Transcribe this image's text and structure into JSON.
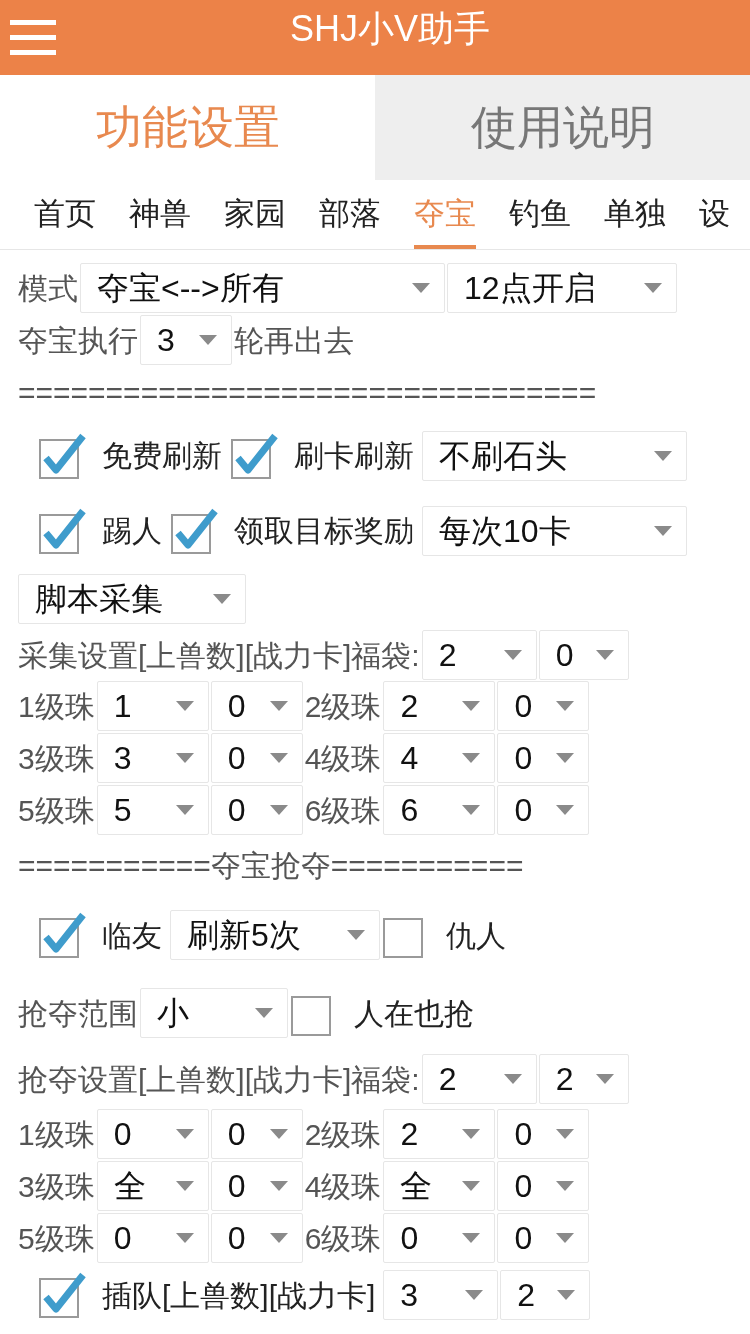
{
  "app_bar": {
    "title": "SHJ小V助手"
  },
  "main_tabs": [
    {
      "label": "功能设置",
      "selected": true
    },
    {
      "label": "使用说明",
      "selected": false
    }
  ],
  "sub_tabs": [
    {
      "label": "首页",
      "selected": false
    },
    {
      "label": "神兽",
      "selected": false
    },
    {
      "label": "家园",
      "selected": false
    },
    {
      "label": "部落",
      "selected": false
    },
    {
      "label": "夺宝",
      "selected": true
    },
    {
      "label": "钓鱼",
      "selected": false
    },
    {
      "label": "单独",
      "selected": false
    },
    {
      "label": "设",
      "selected": false
    }
  ],
  "rows": [
    {
      "items": [
        {
          "kind": "label",
          "text": "模式"
        },
        {
          "kind": "select",
          "value": "夺宝<-->所有"
        },
        {
          "kind": "select",
          "value": "12点开启"
        }
      ]
    },
    {
      "items": [
        {
          "kind": "label",
          "text": "夺宝执行"
        },
        {
          "kind": "select",
          "value": "3"
        },
        {
          "kind": "label",
          "text": "轮再出去"
        }
      ]
    },
    {
      "items": [
        {
          "kind": "label",
          "text": "================================="
        }
      ]
    },
    {
      "items": [
        {
          "kind": "check",
          "text": "免费刷新",
          "checked": true
        },
        {
          "kind": "check",
          "text": "刷卡刷新",
          "checked": true
        },
        {
          "kind": "select",
          "value": "不刷石头"
        }
      ]
    },
    {
      "items": [
        {
          "kind": "check",
          "text": "踢人",
          "checked": true
        },
        {
          "kind": "check",
          "text": "领取目标奖励",
          "checked": true
        },
        {
          "kind": "select",
          "value": "每次10卡"
        }
      ]
    },
    {
      "items": [
        {
          "kind": "select",
          "value": "脚本采集"
        }
      ]
    },
    {
      "items": [
        {
          "kind": "label",
          "text": "采集设置[上兽数][战力卡]福袋:"
        },
        {
          "kind": "select",
          "value": "2"
        },
        {
          "kind": "select",
          "value": "0"
        }
      ]
    },
    {
      "items": [
        {
          "kind": "label",
          "text": "1级珠"
        },
        {
          "kind": "select",
          "value": "1"
        },
        {
          "kind": "select",
          "value": "0"
        },
        {
          "kind": "label",
          "text": "2级珠"
        },
        {
          "kind": "select",
          "value": "2"
        },
        {
          "kind": "select",
          "value": "0"
        }
      ]
    },
    {
      "items": [
        {
          "kind": "label",
          "text": "3级珠"
        },
        {
          "kind": "select",
          "value": "3"
        },
        {
          "kind": "select",
          "value": "0"
        },
        {
          "kind": "label",
          "text": "4级珠"
        },
        {
          "kind": "select",
          "value": "4"
        },
        {
          "kind": "select",
          "value": "0"
        }
      ]
    },
    {
      "items": [
        {
          "kind": "label",
          "text": "5级珠"
        },
        {
          "kind": "select",
          "value": "5"
        },
        {
          "kind": "select",
          "value": "0"
        },
        {
          "kind": "label",
          "text": "6级珠"
        },
        {
          "kind": "select",
          "value": "6"
        },
        {
          "kind": "select",
          "value": "0"
        }
      ]
    },
    {
      "items": [
        {
          "kind": "label",
          "text": "===========夺宝抢夺==========="
        }
      ]
    },
    {
      "items": [
        {
          "kind": "check",
          "text": "临友",
          "checked": true
        },
        {
          "kind": "select",
          "value": "刷新5次"
        },
        {
          "kind": "check",
          "text": "仇人",
          "checked": false
        }
      ]
    },
    {
      "items": [
        {
          "kind": "label",
          "text": "抢夺范围"
        },
        {
          "kind": "select",
          "value": "小"
        },
        {
          "kind": "check",
          "text": "人在也抢",
          "checked": false
        }
      ]
    },
    {
      "items": [
        {
          "kind": "label",
          "text": "抢夺设置[上兽数][战力卡]福袋:"
        },
        {
          "kind": "select",
          "value": "2"
        },
        {
          "kind": "select",
          "value": "2"
        }
      ]
    },
    {
      "items": [
        {
          "kind": "label",
          "text": "1级珠"
        },
        {
          "kind": "select",
          "value": "0"
        },
        {
          "kind": "select",
          "value": "0"
        },
        {
          "kind": "label",
          "text": "2级珠"
        },
        {
          "kind": "select",
          "value": "2"
        },
        {
          "kind": "select",
          "value": "0"
        }
      ]
    },
    {
      "items": [
        {
          "kind": "label",
          "text": "3级珠"
        },
        {
          "kind": "select",
          "value": "全"
        },
        {
          "kind": "select",
          "value": "0"
        },
        {
          "kind": "label",
          "text": "4级珠"
        },
        {
          "kind": "select",
          "value": "全"
        },
        {
          "kind": "select",
          "value": "0"
        }
      ]
    },
    {
      "items": [
        {
          "kind": "label",
          "text": "5级珠"
        },
        {
          "kind": "select",
          "value": "0"
        },
        {
          "kind": "select",
          "value": "0"
        },
        {
          "kind": "label",
          "text": "6级珠"
        },
        {
          "kind": "select",
          "value": "0"
        },
        {
          "kind": "select",
          "value": "0"
        }
      ]
    },
    {
      "items": [
        {
          "kind": "check",
          "text": "插队[上兽数][战力卡]",
          "checked": true
        },
        {
          "kind": "select",
          "value": "3"
        },
        {
          "kind": "select",
          "value": "2"
        }
      ]
    }
  ]
}
